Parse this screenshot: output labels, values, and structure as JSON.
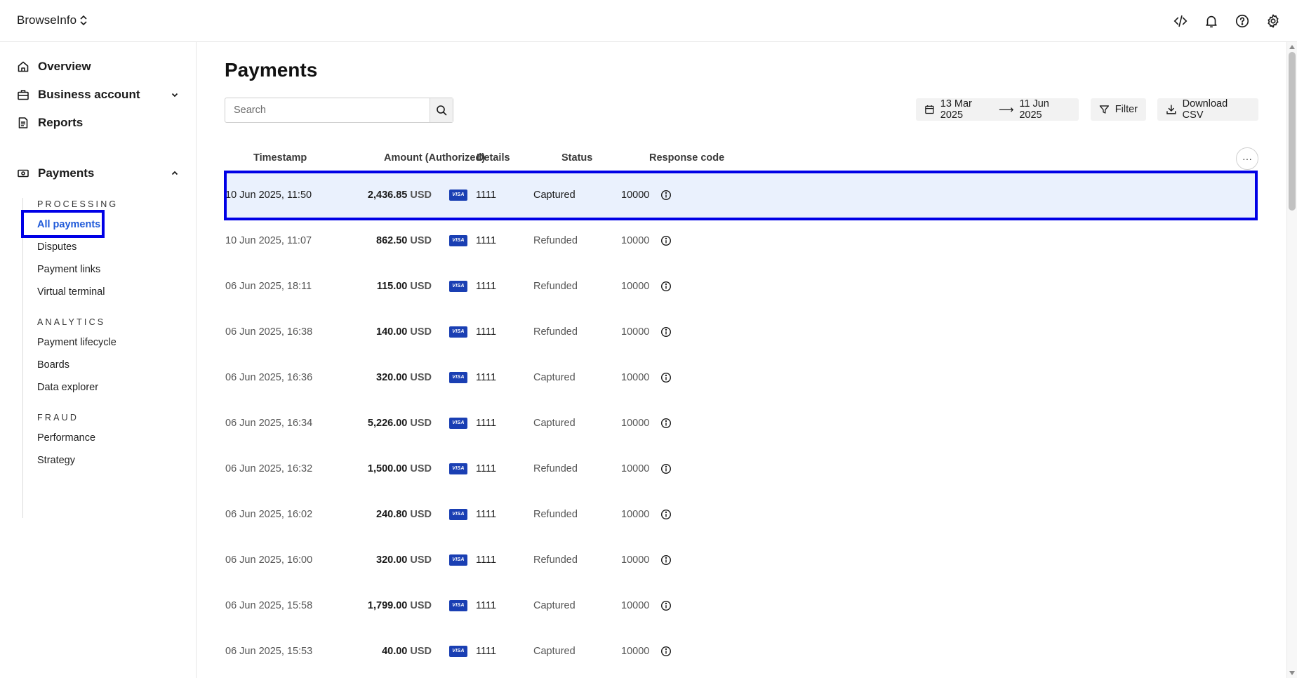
{
  "app": {
    "name": "BrowseInfo"
  },
  "topbar": {
    "icons": [
      "code-icon",
      "bell-icon",
      "help-icon",
      "settings-icon"
    ]
  },
  "sidebar": {
    "overview": "Overview",
    "business_account": "Business account",
    "reports": "Reports",
    "payments": "Payments",
    "sections": {
      "processing": "PROCESSING",
      "analytics": "ANALYTICS",
      "fraud": "FRAUD"
    },
    "processing_items": [
      "All payments",
      "Disputes",
      "Payment links",
      "Virtual terminal"
    ],
    "analytics_items": [
      "Payment lifecycle",
      "Boards",
      "Data explorer"
    ],
    "fraud_items": [
      "Performance",
      "Strategy"
    ],
    "active_item": "All payments"
  },
  "main": {
    "title": "Payments",
    "search": {
      "placeholder": "Search",
      "value": ""
    },
    "date_range": {
      "from": "13 Mar 2025",
      "to": "11 Jun 2025"
    },
    "filter_label": "Filter",
    "download_label": "Download CSV",
    "more_label": "···",
    "columns": [
      "Timestamp",
      "Amount (Authorized)",
      "Details",
      "Status",
      "Response code"
    ],
    "rows": [
      {
        "timestamp": "10 Jun 2025, 11:50",
        "amount": "2,436.85",
        "currency": "USD",
        "card": "1111",
        "status": "Captured",
        "code": "10000"
      },
      {
        "timestamp": "10 Jun 2025, 11:07",
        "amount": "862.50",
        "currency": "USD",
        "card": "1111",
        "status": "Refunded",
        "code": "10000"
      },
      {
        "timestamp": "06 Jun 2025, 18:11",
        "amount": "115.00",
        "currency": "USD",
        "card": "1111",
        "status": "Refunded",
        "code": "10000"
      },
      {
        "timestamp": "06 Jun 2025, 16:38",
        "amount": "140.00",
        "currency": "USD",
        "card": "1111",
        "status": "Refunded",
        "code": "10000"
      },
      {
        "timestamp": "06 Jun 2025, 16:36",
        "amount": "320.00",
        "currency": "USD",
        "card": "1111",
        "status": "Captured",
        "code": "10000"
      },
      {
        "timestamp": "06 Jun 2025, 16:34",
        "amount": "5,226.00",
        "currency": "USD",
        "card": "1111",
        "status": "Captured",
        "code": "10000"
      },
      {
        "timestamp": "06 Jun 2025, 16:32",
        "amount": "1,500.00",
        "currency": "USD",
        "card": "1111",
        "status": "Refunded",
        "code": "10000"
      },
      {
        "timestamp": "06 Jun 2025, 16:02",
        "amount": "240.80",
        "currency": "USD",
        "card": "1111",
        "status": "Refunded",
        "code": "10000"
      },
      {
        "timestamp": "06 Jun 2025, 16:00",
        "amount": "320.00",
        "currency": "USD",
        "card": "1111",
        "status": "Refunded",
        "code": "10000"
      },
      {
        "timestamp": "06 Jun 2025, 15:58",
        "amount": "1,799.00",
        "currency": "USD",
        "card": "1111",
        "status": "Captured",
        "code": "10000"
      },
      {
        "timestamp": "06 Jun 2025, 15:53",
        "amount": "40.00",
        "currency": "USD",
        "card": "1111",
        "status": "Captured",
        "code": "10000"
      }
    ],
    "card_brand": "VISA"
  },
  "colors": {
    "accent": "#1f5ad9",
    "highlight_border": "#0000e6",
    "selected_row": "#eaf1fd",
    "visa": "#1a3fb3"
  }
}
